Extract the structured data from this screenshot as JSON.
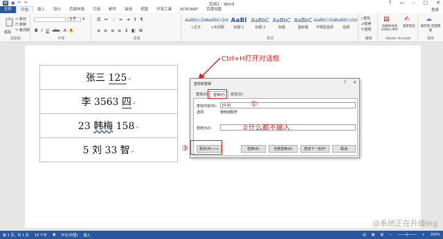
{
  "window": {
    "title": "文档1 - Word",
    "controls": [
      "?",
      "▭",
      "–",
      "□",
      "✕"
    ]
  },
  "tabs": {
    "file": "文件",
    "items": [
      "开始",
      "插入",
      "设计",
      "页面布局",
      "引用",
      "邮件",
      "审阅",
      "视图",
      "开发工具",
      "ACROBAT",
      "百度网盘"
    ],
    "active": "开始",
    "login": "登录"
  },
  "ribbon": {
    "clipboard": {
      "label": "剪贴板",
      "paste": "粘贴",
      "cut": "剪切",
      "copy": "复制",
      "format_painter": "格式刷"
    },
    "font": {
      "label": "字体",
      "size": "五号"
    },
    "paragraph": {
      "label": "段落"
    },
    "styles": {
      "label": "样式",
      "items": [
        {
          "preview": "AaBbCcDd",
          "name": "+正文"
        },
        {
          "preview": "AaBbCcDd",
          "name": "+无间隔"
        },
        {
          "preview": "AaBl",
          "name": "标题 1"
        },
        {
          "preview": "AaBbC",
          "name": "标题 2"
        },
        {
          "preview": "AaBbC",
          "name": "标题"
        },
        {
          "preview": "AaBbC",
          "name": "副标题"
        },
        {
          "preview": "AaBbCcDd",
          "name": "不明显强调"
        },
        {
          "preview": "AaBbCcDd",
          "name": "强调"
        }
      ]
    },
    "editing": {
      "label": "编辑",
      "find": "查找",
      "replace": "替换",
      "select": "选择"
    },
    "acrobat": {
      "label": "Adobe Acrobat",
      "create_pdf": "创建并共享 Adobe PDF",
      "sign": "请求签名"
    },
    "save": {
      "label": "保存",
      "save_to": "保存到 百度网盘"
    }
  },
  "document": {
    "rows": [
      {
        "parts": [
          "张三 ",
          "125"
        ]
      },
      {
        "parts": [
          "李 3563 ",
          "四"
        ]
      },
      {
        "parts": [
          "23 ",
          "韩梅",
          " 158"
        ]
      },
      {
        "parts": [
          "5 刘 33 智"
        ]
      }
    ]
  },
  "annotations": {
    "ctrl_h": "Ctrl+H打开对话框",
    "step1": "①",
    "step2": "②什么都不输入",
    "step3": "③"
  },
  "dialog": {
    "title": "查找和替换",
    "help": "?",
    "close": "✕",
    "tabs": [
      "查找(D)",
      "替换(P)",
      "定位(G)"
    ],
    "active_tab": "替换(P)",
    "find_label": "查找内容(N):",
    "find_value": "[0-9]",
    "options_label": "选项:",
    "options_value": "使用通配符",
    "replace_label": "替换为(I):",
    "replace_value": "",
    "buttons": {
      "more": "更多(M) >>",
      "replace": "替换(R)",
      "replace_all": "全部替换(A)",
      "find_next": "查找下一处(F)",
      "cancel": "取消"
    }
  },
  "statusbar": {
    "page": "第 1 页，共 1 页",
    "words": "14 个字",
    "language": "中文(中国)",
    "mode": "插入",
    "zoom": "200%"
  },
  "watermark": "@系统正在升级ing"
}
